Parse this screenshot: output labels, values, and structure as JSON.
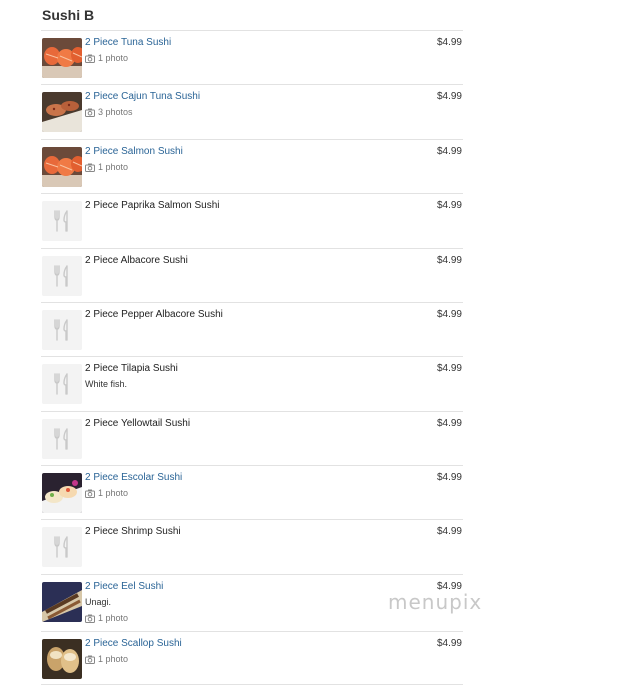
{
  "section": {
    "title": "Sushi B"
  },
  "watermark": "menupix",
  "items": [
    {
      "name": "2 Piece Tuna Sushi",
      "price": "$4.99",
      "photos": "1 photo",
      "thumb": "salmon"
    },
    {
      "name": "2 Piece Cajun Tuna Sushi",
      "price": "$4.99",
      "photos": "3 photos",
      "thumb": "cajun"
    },
    {
      "name": "2 Piece Salmon Sushi",
      "price": "$4.99",
      "photos": "1 photo",
      "thumb": "salmon"
    },
    {
      "name": "2 Piece Paprika Salmon Sushi",
      "price": "$4.99",
      "thumb": "placeholder"
    },
    {
      "name": "2 Piece Albacore Sushi",
      "price": "$4.99",
      "thumb": "placeholder"
    },
    {
      "name": "2 Piece Pepper Albacore Sushi",
      "price": "$4.99",
      "thumb": "placeholder"
    },
    {
      "name": "2 Piece Tilapia Sushi",
      "price": "$4.99",
      "description": "White fish.",
      "thumb": "placeholder"
    },
    {
      "name": "2 Piece Yellowtail Sushi",
      "price": "$4.99",
      "thumb": "placeholder"
    },
    {
      "name": "2 Piece Escolar Sushi",
      "price": "$4.99",
      "photos": "1 photo",
      "thumb": "escolar"
    },
    {
      "name": "2 Piece Shrimp Sushi",
      "price": "$4.99",
      "thumb": "placeholder"
    },
    {
      "name": "2 Piece Eel Sushi",
      "price": "$4.99",
      "description": "Unagi.",
      "photos": "1 photo",
      "thumb": "eel"
    },
    {
      "name": "2 Piece Scallop Sushi",
      "price": "$4.99",
      "photos": "1 photo",
      "thumb": "scallop"
    }
  ]
}
